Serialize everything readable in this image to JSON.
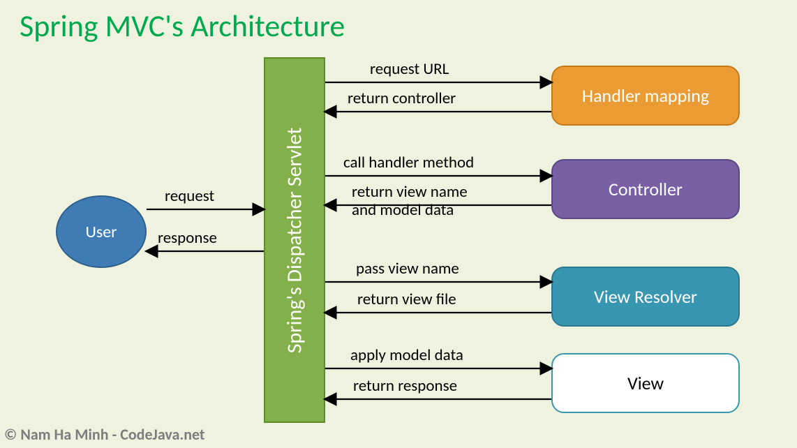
{
  "title": "Spring MVC's Architecture",
  "copyright": "© Nam Ha Minh - CodeJava.net",
  "nodes": {
    "user": "User",
    "dispatcher": "Spring's Dispatcher Servlet",
    "handler_mapping": "Handler mapping",
    "controller": "Controller",
    "view_resolver": "View Resolver",
    "view": "View"
  },
  "edges": {
    "user_to_dispatcher": "request",
    "dispatcher_to_user": "response",
    "to_handler_mapping": "request URL",
    "from_handler_mapping": "return controller",
    "to_controller": "call handler method",
    "from_controller": "return view name\nand model data",
    "to_view_resolver": "pass view name",
    "from_view_resolver": "return view file",
    "to_view": "apply model data",
    "from_view": "return response"
  }
}
